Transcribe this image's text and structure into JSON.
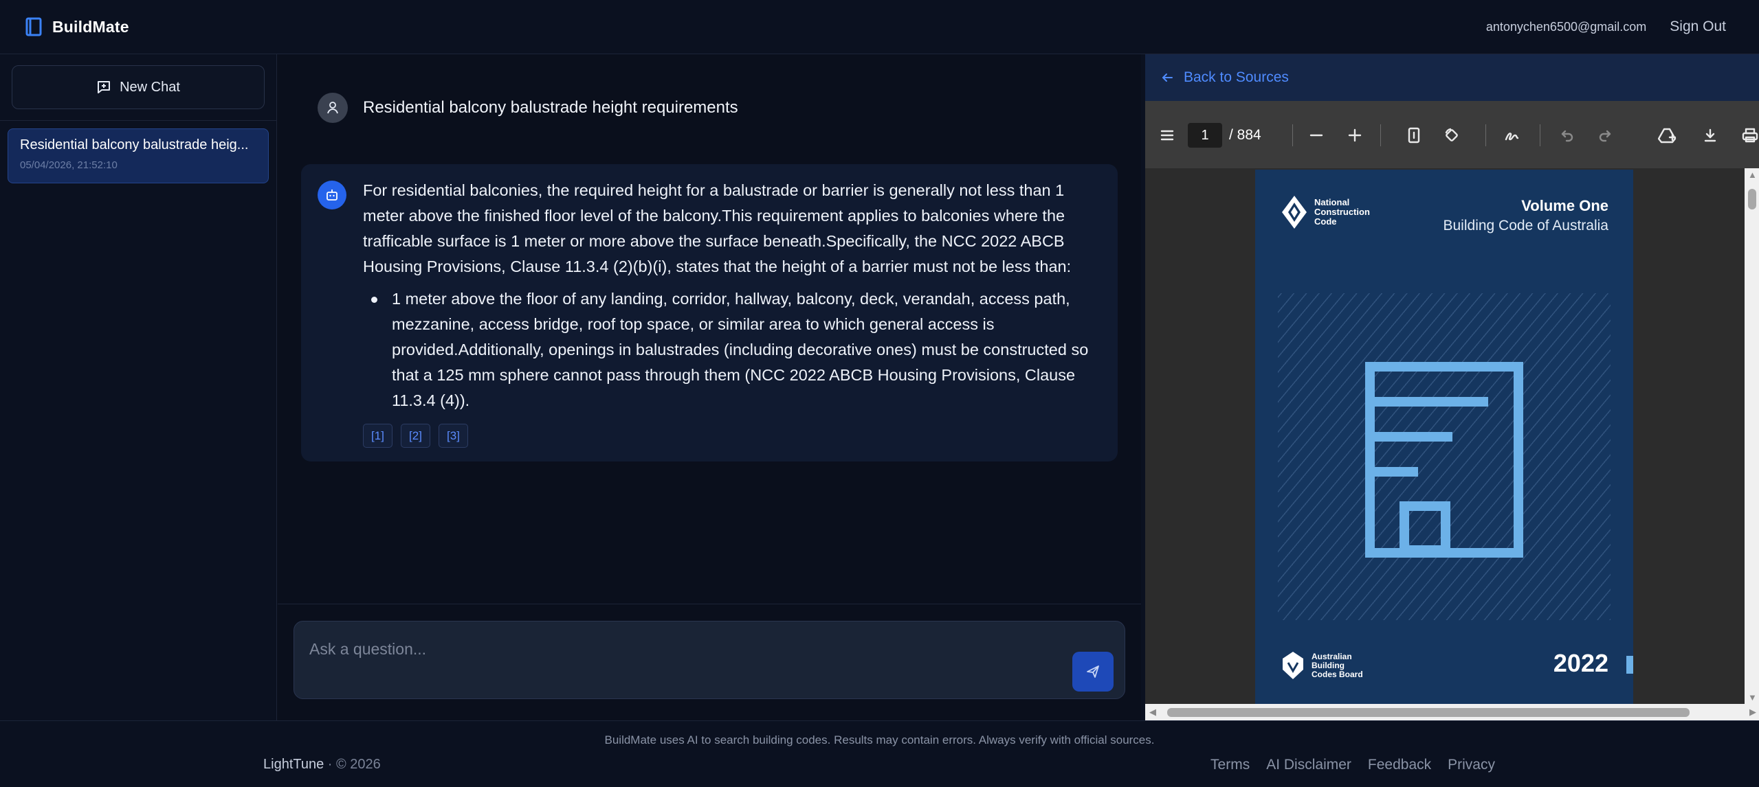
{
  "app": {
    "name": "BuildMate",
    "user_email": "antonychen6500@gmail.com",
    "sign_out": "Sign Out"
  },
  "sidebar": {
    "new_chat_label": "New Chat",
    "chats": [
      {
        "title": "Residential balcony balustrade heig...",
        "date": "05/04/2026, 21:52:10"
      }
    ]
  },
  "conversation": {
    "user_message": "Residential balcony balustrade height requirements",
    "bot_paragraph": "For residential balconies, the required height for a balustrade or barrier is generally not less than 1 meter above the finished floor level of the balcony.This requirement applies to balconies where the trafficable surface is 1 meter or more above the surface beneath.Specifically, the NCC 2022 ABCB Housing Provisions, Clause 11.3.4 (2)(b)(i), states that the height of a barrier must not be less than:",
    "bot_bullets": [
      "1 meter above the floor of any landing, corridor, hallway, balcony, deck, verandah, access path, mezzanine, access bridge, roof top space, or similar area to which general access is provided.Additionally, openings in balustrades (including decorative ones) must be constructed so that a 125 mm sphere cannot pass through them (NCC 2022 ABCB Housing Provisions, Clause 11.3.4 (4))."
    ],
    "citations": [
      "[1]",
      "[2]",
      "[3]"
    ]
  },
  "composer": {
    "placeholder": "Ask a question...",
    "value": ""
  },
  "pdf_panel": {
    "back_label": "Back to Sources",
    "current_page": "1",
    "total_pages": "/ 884",
    "cover": {
      "publisher_line1": "National",
      "publisher_line2": "Construction",
      "publisher_line3": "Code",
      "volume": "Volume One",
      "subtitle": "Building Code of Australia",
      "board_line1": "Australian",
      "board_line2": "Building",
      "board_line3": "Codes Board",
      "year": "2022"
    }
  },
  "footer": {
    "disclaimer": "BuildMate uses AI to search building codes. Results may contain errors. Always verify with official sources.",
    "company": "LightTune",
    "copyright": "· © 2026",
    "links": [
      "Terms",
      "AI Disclaimer",
      "Feedback",
      "Privacy"
    ]
  },
  "colors": {
    "accent": "#2563eb",
    "link": "#4f8bff",
    "background": "#0a0f1c",
    "cover_blue": "#15365f",
    "cover_icon": "#6cb1e8"
  },
  "icons": [
    "book-icon",
    "chat-plus-icon",
    "user-icon",
    "bot-icon",
    "send-icon",
    "arrow-left-icon",
    "menu-icon",
    "zoom-out-icon",
    "zoom-in-icon",
    "page-fit-icon",
    "rotate-icon",
    "draw-icon",
    "undo-icon",
    "redo-icon",
    "add-drive-icon",
    "download-icon",
    "print-icon"
  ]
}
